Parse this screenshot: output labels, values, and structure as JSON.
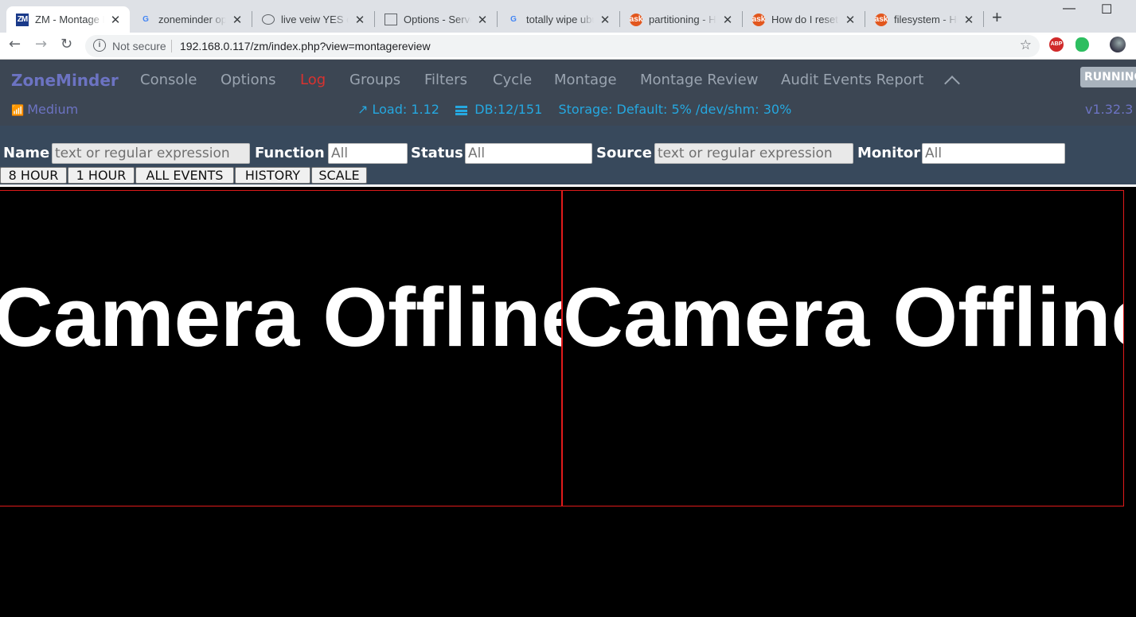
{
  "browser": {
    "tabs": [
      {
        "title": "ZM - Montage Review",
        "icon": "zm-icon",
        "icon_text": "ZM"
      },
      {
        "title": "zoneminder options",
        "icon": "google-icon",
        "icon_text": "G"
      },
      {
        "title": "live veiw YES on first",
        "icon": "globe-icon",
        "icon_text": ""
      },
      {
        "title": "Options - Servers",
        "icon": "document-icon",
        "icon_text": ""
      },
      {
        "title": "totally wipe ubuntu",
        "icon": "google-icon",
        "icon_text": "G"
      },
      {
        "title": "partitioning - How",
        "icon": "askubuntu-icon",
        "icon_text": "ask"
      },
      {
        "title": "How do I reset Ubuntu",
        "icon": "askubuntu-icon",
        "icon_text": "ask"
      },
      {
        "title": "filesystem - How",
        "icon": "askubuntu-icon",
        "icon_text": "ask"
      }
    ],
    "close_glyph": "✕",
    "new_tab_glyph": "+",
    "security": "Not secure",
    "url": "192.168.0.117/zm/index.php?view=montagereview"
  },
  "zm": {
    "brand": "ZoneMinder",
    "nav": [
      "Console",
      "Options",
      "Log",
      "Groups",
      "Filters",
      "Cycle",
      "Montage",
      "Montage Review",
      "Audit Events Report"
    ],
    "state": "RUNNING",
    "bandwidth": "Medium",
    "load": "Load: 1.12",
    "db": "DB:12/151",
    "storage": "Storage: Default: 5% /dev/shm: 30%",
    "version": "v1.32.3"
  },
  "filters": {
    "name_label": "Name",
    "name_placeholder": "text or regular expression",
    "function_label": "Function",
    "function_value": "All",
    "status_label": "Status",
    "status_value": "All",
    "source_label": "Source",
    "source_placeholder": "text or regular expression",
    "monitor_label": "Monitor",
    "monitor_value": "All"
  },
  "buttons": [
    "8 HOUR",
    "1 HOUR",
    "ALL EVENTS",
    "HISTORY",
    "SCALE"
  ],
  "monitors": [
    {
      "status": "Camera Offline"
    },
    {
      "status": "Camera Offline"
    }
  ],
  "colors": {
    "nav_bg": "#3c4653",
    "filter_bg": "#38495c",
    "brand": "#6c73c2",
    "log": "#d9322f",
    "stats": "#25a8e0",
    "monitor_border": "#e01a1a"
  }
}
